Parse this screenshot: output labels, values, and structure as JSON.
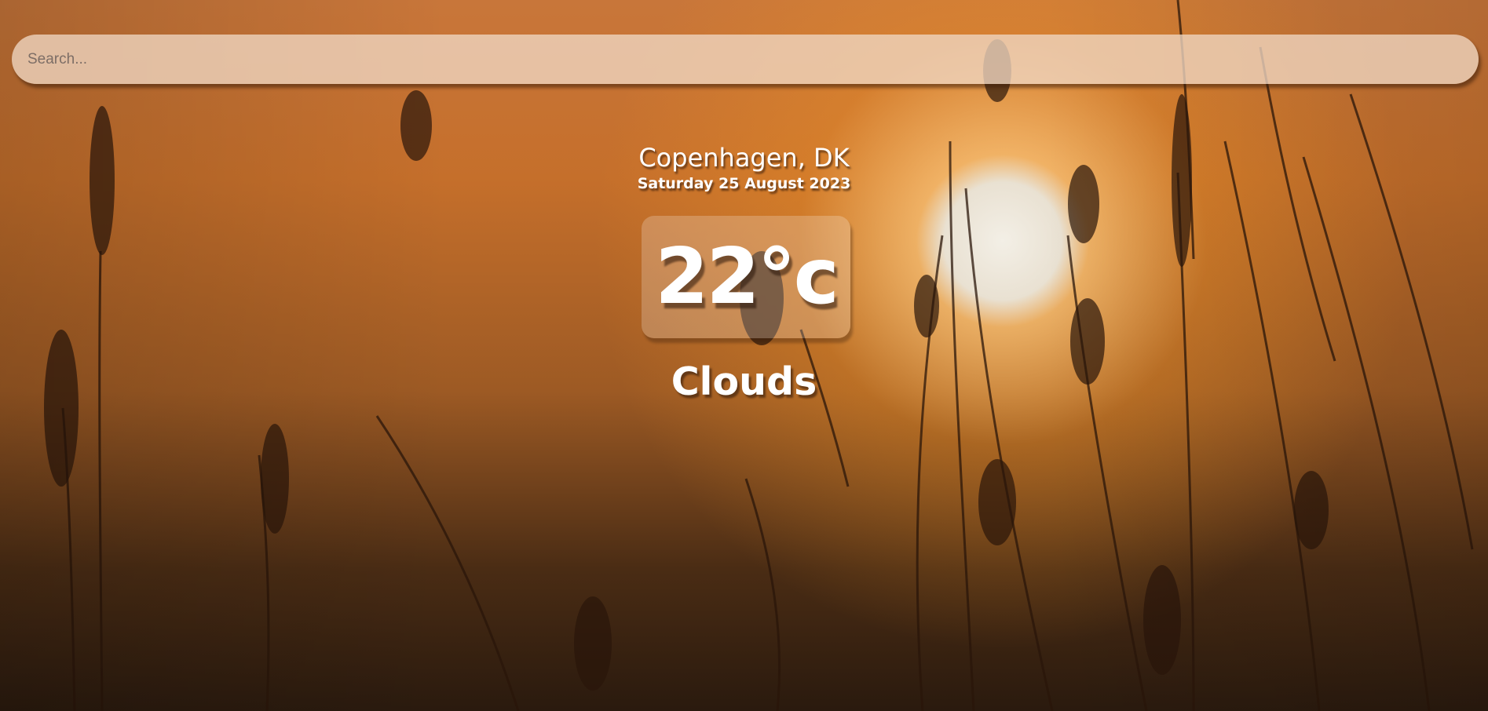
{
  "search": {
    "placeholder": "Search...",
    "value": ""
  },
  "location": {
    "city": "Copenhagen, DK",
    "date": "Saturday 25 August 2023"
  },
  "weather": {
    "temperature": "22°c",
    "condition": "Clouds"
  },
  "theme": {
    "background": "sunset-grass-photo",
    "text_color": "#ffffff"
  }
}
